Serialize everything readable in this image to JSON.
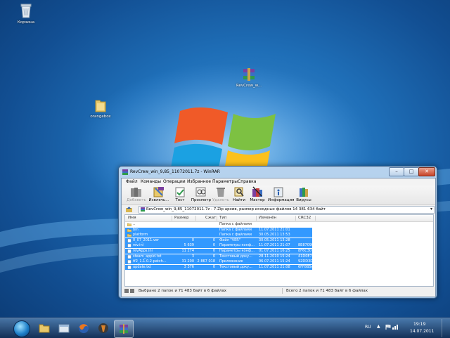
{
  "desktop": {
    "icons": [
      {
        "label": "Корзина",
        "icon": "recycle-bin-icon"
      },
      {
        "label": "RevCrew_w...",
        "icon": "winrar-archive-icon"
      },
      {
        "label": "orangebox",
        "icon": "folder-icon"
      }
    ]
  },
  "window": {
    "title": "RevCrew_win_9,85_11072011.7z - 7-Zip архив, размер исходных файлов 14 381 634 байт",
    "title_short": "RevCrew_win_9,85_11072011.7z - WinRAR",
    "controls": {
      "minimize": "–",
      "maximize": "□",
      "close": "✕"
    },
    "menu": [
      "Файл",
      "Команды",
      "Операции",
      "Избранное",
      "Параметры",
      "Справка"
    ],
    "toolbar": [
      {
        "label": "Добавить",
        "icon": "add-books-icon",
        "enabled": false
      },
      {
        "label": "Извлечь...",
        "icon": "extract-icon",
        "enabled": true
      },
      {
        "label": "Тест",
        "icon": "test-icon",
        "enabled": true
      },
      {
        "label": "Просмотр",
        "icon": "view-icon",
        "enabled": true
      },
      {
        "label": "Удалить",
        "icon": "delete-icon",
        "enabled": false
      },
      {
        "label": "Найти",
        "icon": "find-icon",
        "enabled": true
      },
      {
        "label": "Мастер",
        "icon": "wizard-icon",
        "enabled": true
      },
      {
        "label": "Информация",
        "icon": "info-icon",
        "enabled": true
      },
      {
        "label": "Вирусы",
        "icon": "virus-scan-icon",
        "enabled": true
      }
    ],
    "columns": [
      "Имя",
      "Размер",
      "Сжат",
      "Тип",
      "Изменён",
      "CRC32"
    ],
    "files": [
      {
        "name": "..",
        "size": "",
        "packed": "",
        "type": "Папка с файлами",
        "modified": "",
        "crc": "",
        "selected": false,
        "kind": "up"
      },
      {
        "name": "bin",
        "size": "",
        "packed": "",
        "type": "Папка с файлами",
        "modified": "11.07.2011 21:01",
        "crc": "",
        "selected": true,
        "kind": "folder"
      },
      {
        "name": "platform",
        "size": "",
        "packed": "",
        "type": "Папка с файлами",
        "modified": "30.05.2011 13:53",
        "crc": "",
        "selected": true,
        "kind": "folder"
      },
      {
        "name": "0_07_2011.ver",
        "size": "0",
        "packed": "0",
        "type": "Файл \"VER\"",
        "modified": "30.05.2011 13:28",
        "crc": "",
        "selected": true,
        "kind": "file"
      },
      {
        "name": "rev.ini",
        "size": "5 639",
        "packed": "0",
        "type": "Параметры конф...",
        "modified": "11.07.2011 21:07",
        "crc": "8E8709DB",
        "selected": true,
        "kind": "file"
      },
      {
        "name": "revApps.ini",
        "size": "11 274",
        "packed": "0",
        "type": "Параметры конф...",
        "modified": "01.07.2011 16:25",
        "crc": "8F6C307A",
        "selected": true,
        "kind": "file"
      },
      {
        "name": "steam_appid.txt",
        "size": "3",
        "packed": "0",
        "type": "Текстовый доку...",
        "modified": "28.11.2010 15:24",
        "crc": "41D0E7F8",
        "selected": true,
        "kind": "file"
      },
      {
        "name": "tf2_1.1.0.2-patch...",
        "size": "31 200",
        "packed": "2 867 018",
        "type": "Приложение",
        "modified": "06.07.2011 15:24",
        "crc": "92DD3DF5",
        "selected": true,
        "kind": "file"
      },
      {
        "name": "update.txt",
        "size": "3 376",
        "packed": "0",
        "type": "Текстовый доку...",
        "modified": "11.07.2011 21:08",
        "crc": "6FF8B5A7",
        "selected": true,
        "kind": "file"
      }
    ],
    "status_left": "Выбрано 2 папок и 71 483 байт в 6 файлах",
    "status_right": "Всего 2 папок и 71 483 байт в 6 файлах"
  },
  "taskbar": {
    "buttons": [
      {
        "name": "explorer",
        "icon": "folder-icon"
      },
      {
        "name": "windows-explorer-2",
        "icon": "explorer-window-icon"
      },
      {
        "name": "firefox",
        "icon": "firefox-icon"
      },
      {
        "name": "game",
        "icon": "tf2-icon"
      },
      {
        "name": "winrar",
        "icon": "winrar-icon",
        "active": true
      }
    ],
    "language": "RU",
    "time": "19:19",
    "date": "14.07.2011"
  }
}
